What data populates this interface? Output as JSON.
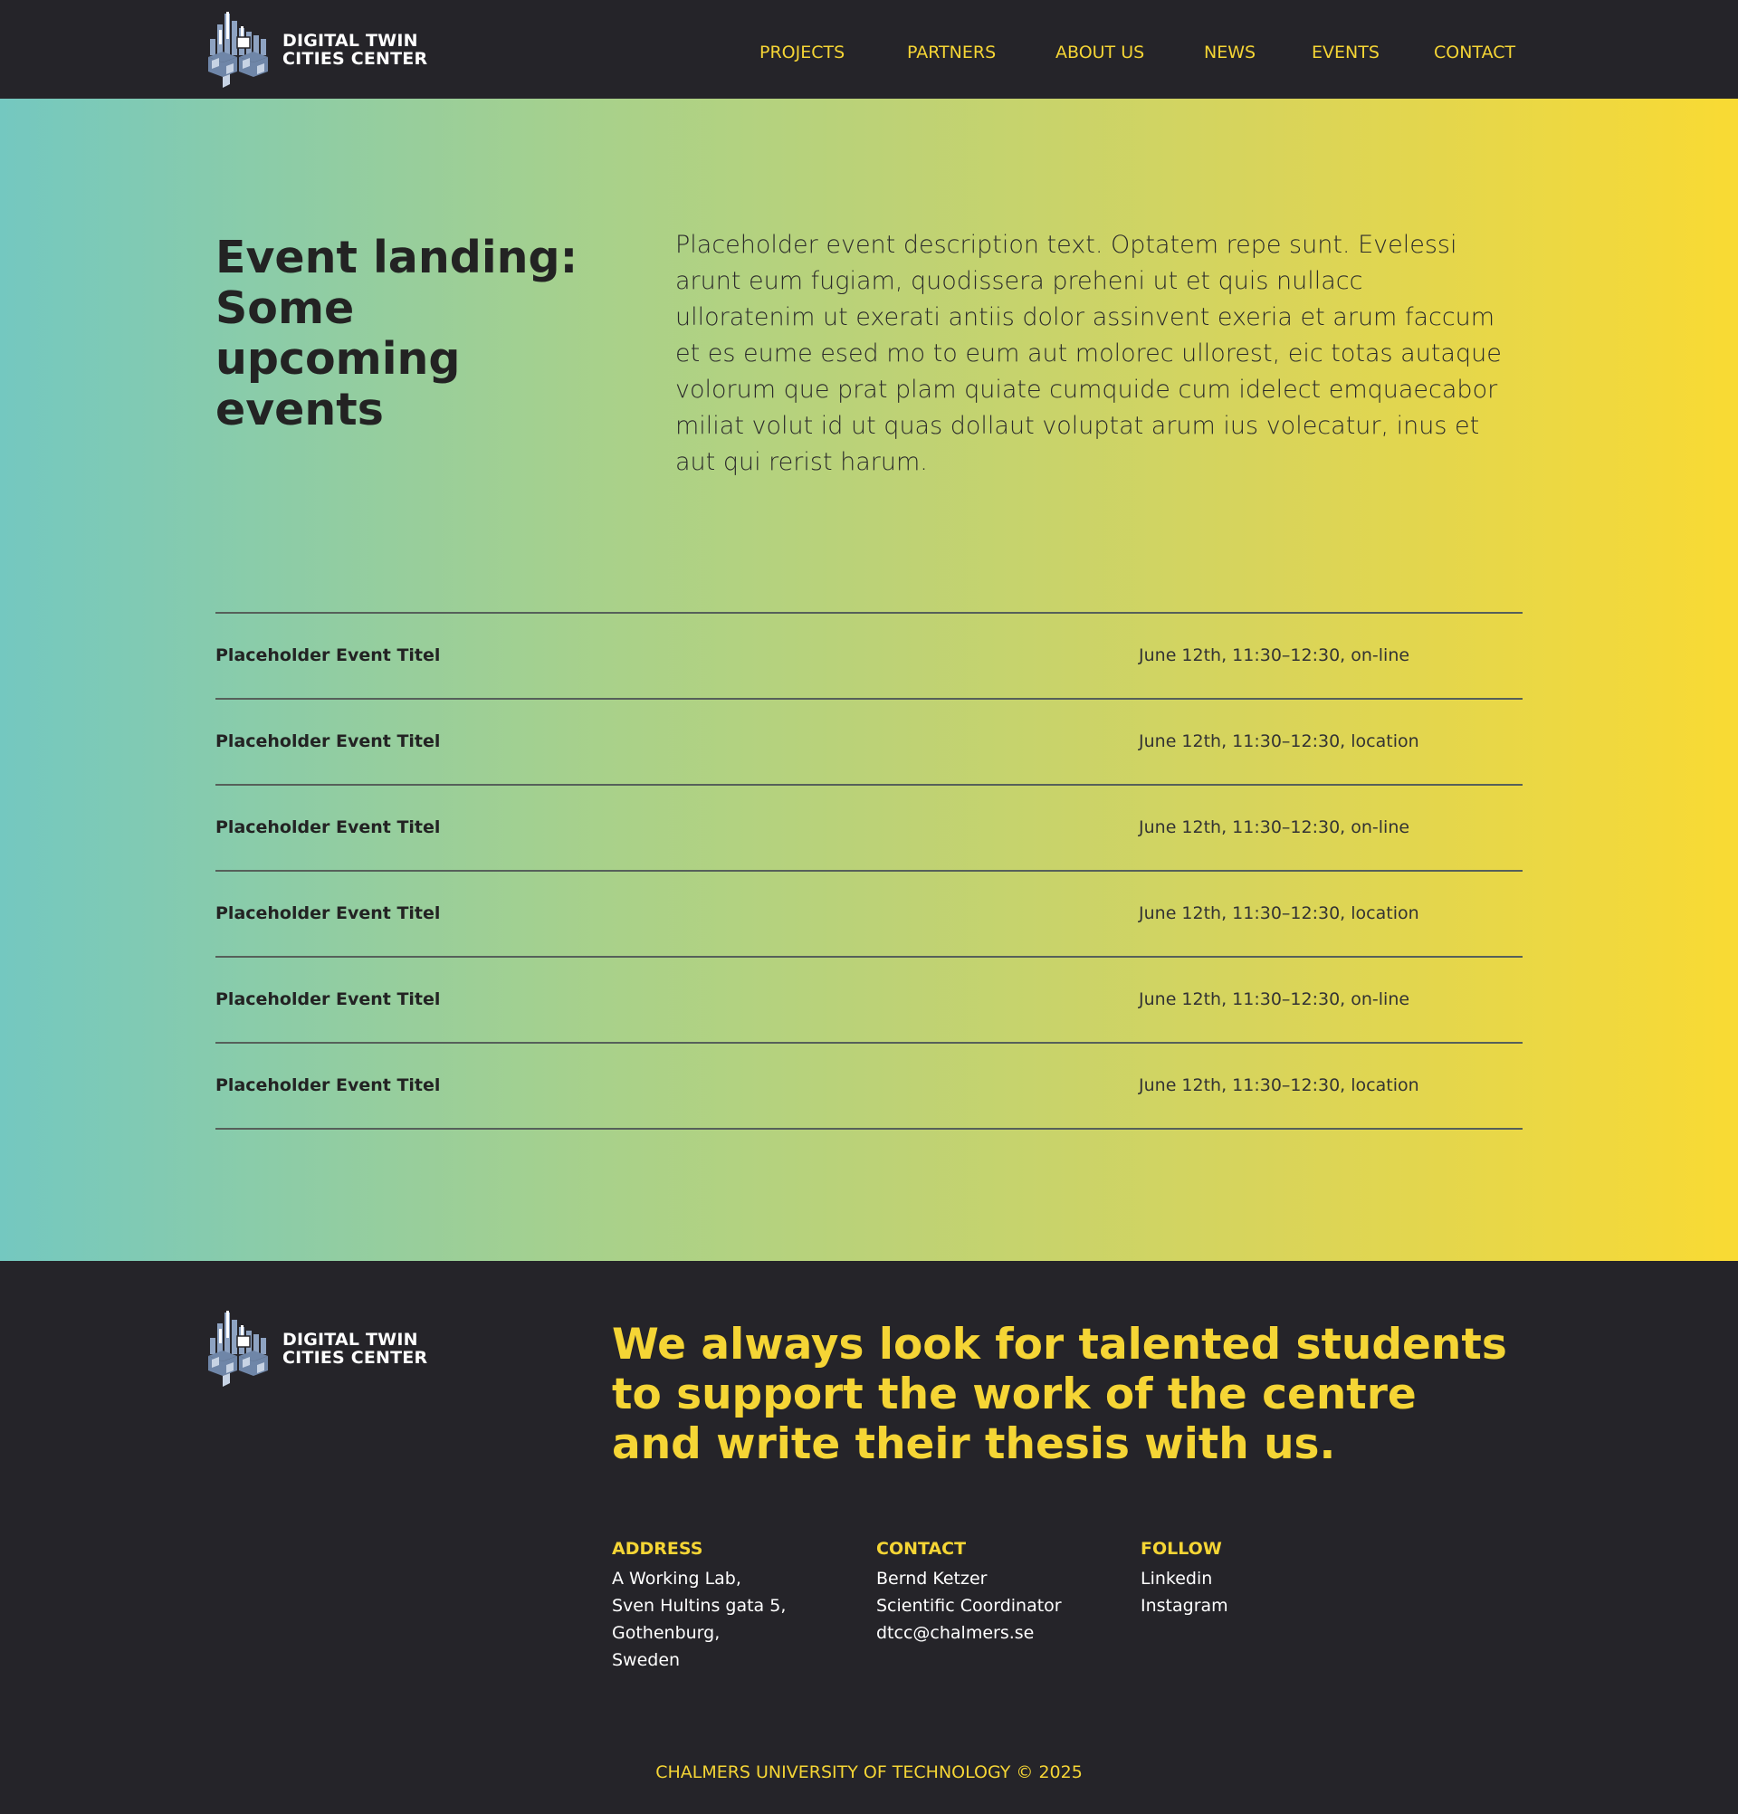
{
  "brand": {
    "line1": "DIGITAL TWIN",
    "line2": "CITIES CENTER",
    "logo_icon": "city-blocks-icon"
  },
  "nav": [
    {
      "label": "PROJECTS"
    },
    {
      "label": "PARTNERS"
    },
    {
      "label": "ABOUT US"
    },
    {
      "label": "NEWS"
    },
    {
      "label": "EVENTS"
    },
    {
      "label": "CONTACT"
    }
  ],
  "hero": {
    "title": "Event landing: Some upcoming events",
    "description": "Placeholder event description text. Optatem repe sunt. Evelessi arunt eum fugiam, quodissera preheni ut et quis nullacc ulloratenim ut exerati antiis dolor assinvent exeria et arum faccum et es eume esed mo to eum aut molorec ullorest, eic totas autaque volorum que prat plam quiate cumquide cum idelect emquaecabor miliat volut id ut quas dollaut voluptat arum ius volecatur, inus et aut qui rerist harum."
  },
  "events": [
    {
      "title": "Placeholder Event Titel",
      "info": "June 12th, 11:30–12:30, on-line"
    },
    {
      "title": "Placeholder Event Titel",
      "info": "June 12th, 11:30–12:30, location"
    },
    {
      "title": "Placeholder Event Titel",
      "info": "June 12th, 11:30–12:30, on-line"
    },
    {
      "title": "Placeholder Event Titel",
      "info": "June 12th, 11:30–12:30, location"
    },
    {
      "title": "Placeholder Event Titel",
      "info": "June 12th, 11:30–12:30, on-line"
    },
    {
      "title": "Placeholder Event Titel",
      "info": "June 12th, 11:30–12:30, location"
    }
  ],
  "footer": {
    "tagline": "We always look for talented students to support the work of the centre and write their thesis with us.",
    "address": {
      "heading": "ADDRESS",
      "lines": [
        "A Working Lab,",
        "Sven Hultins gata 5,",
        "Gothenburg,",
        "Sweden"
      ]
    },
    "contact": {
      "heading": "CONTACT",
      "lines": [
        "Bernd Ketzer",
        "Scientific Coordinator",
        "dtcc@chalmers.se"
      ]
    },
    "follow": {
      "heading": "FOLLOW",
      "lines": [
        "Linkedin",
        "Instagram"
      ]
    },
    "copyright": "CHALMERS UNIVERSITY OF TECHNOLOGY © 2025"
  },
  "colors": {
    "dark": "#252429",
    "accent_yellow": "#f5d535",
    "gradient_start": "#74c8c0",
    "gradient_end": "#f9da33"
  }
}
